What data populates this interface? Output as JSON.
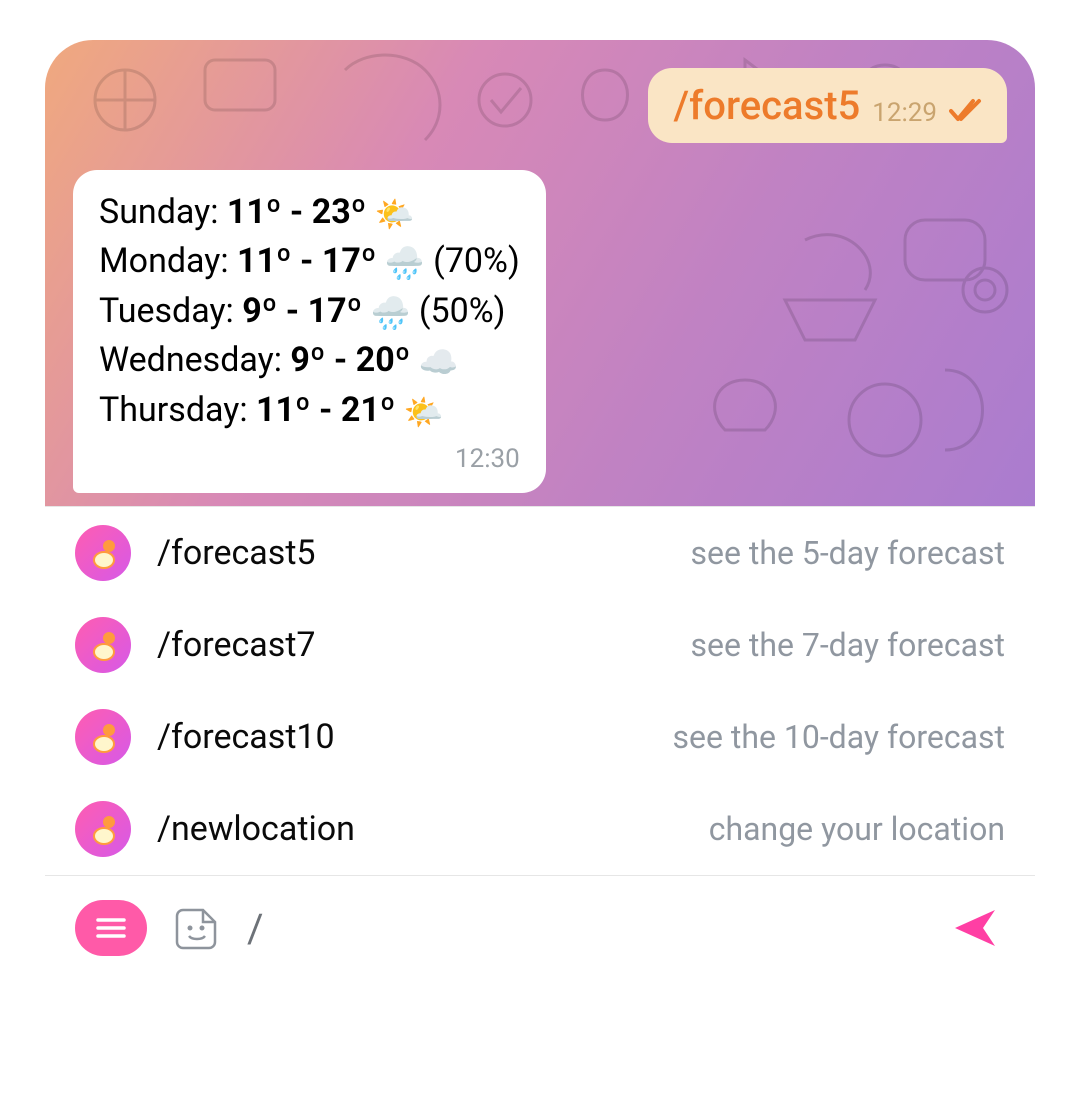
{
  "outgoing": {
    "text": "/forecast5",
    "time": "12:29"
  },
  "incoming": {
    "rows": [
      {
        "day": "Sunday",
        "range": "11º - 23º",
        "icon": "🌤️",
        "extra": ""
      },
      {
        "day": "Monday",
        "range": "11º - 17º",
        "icon": "🌧️",
        "extra": " (70%)"
      },
      {
        "day": "Tuesday",
        "range": "9º - 17º",
        "icon": "🌧️",
        "extra": " (50%)"
      },
      {
        "day": "Wednesday",
        "range": "9º - 20º",
        "icon": "☁️",
        "extra": ""
      },
      {
        "day": "Thursday",
        "range": "11º - 21º",
        "icon": "🌤️",
        "extra": ""
      }
    ],
    "time": "12:30"
  },
  "commands": [
    {
      "cmd": "/forecast5",
      "desc": "see the 5-day forecast"
    },
    {
      "cmd": "/forecast7",
      "desc": "see the 7-day forecast"
    },
    {
      "cmd": "/forecast10",
      "desc": "see the 10-day forecast"
    },
    {
      "cmd": "/newlocation",
      "desc": "change your location"
    }
  ],
  "compose": {
    "value": "/"
  }
}
